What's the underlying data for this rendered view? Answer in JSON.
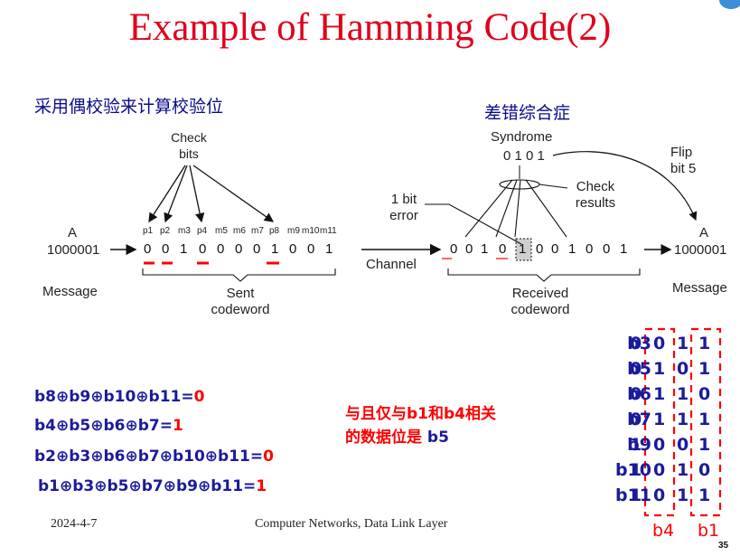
{
  "title": "Example of Hamming Code(2)",
  "left_caption": "采用偶校验来计算校验位",
  "right_caption": "差错综合症",
  "diagram": {
    "check_bits_label": [
      "Check",
      "bits"
    ],
    "sender_a": "A",
    "sender_data": "1000001",
    "message_left": "Message",
    "positions": [
      "p1",
      "p2",
      "m3",
      "p4",
      "m5",
      "m6",
      "m7",
      "p8",
      "m9",
      "m10",
      "m11"
    ],
    "sent_bits": [
      "0",
      "0",
      "1",
      "0",
      "0",
      "0",
      "0",
      "1",
      "0",
      "0",
      "1"
    ],
    "sent_codeword": [
      "Sent",
      "codeword"
    ],
    "channel": "Channel",
    "one_bit_error": [
      "1 bit",
      "error"
    ],
    "syndrome_label": "Syndrome",
    "syndrome_value": "0 1 0 1",
    "check_results": [
      "Check",
      "results"
    ],
    "received_bits": [
      "0",
      "0",
      "1",
      "0",
      "1",
      "0",
      "0",
      "1",
      "0",
      "0",
      "1"
    ],
    "received_codeword": [
      "Received",
      "codeword"
    ],
    "flip_label": [
      "Flip",
      "bit 5"
    ],
    "receiver_a": "A",
    "receiver_data": "1000001",
    "message_right": "Message"
  },
  "equations": [
    {
      "expr": "b8⊕b9⊕b10⊕b11=",
      "result": "0"
    },
    {
      "expr": "b4⊕b5⊕b6⊕b7=",
      "result": "1"
    },
    {
      "expr": "b2⊕b3⊕b6⊕b7⊕b10⊕b11=",
      "result": "0"
    },
    {
      "expr": "b1⊕b3⊕b5⊕b7⊕b9⊕b11=",
      "result": "1"
    }
  ],
  "note": {
    "line1_a": "与且仅与",
    "line1_b": "b1",
    "line1_c": "和",
    "line1_d": "b4",
    "line1_e": "相关",
    "line2_a": "的数据位是 ",
    "line2_b": "b5"
  },
  "table": {
    "rows": [
      {
        "name": "b3",
        "bits": [
          "0",
          "0",
          "1",
          "1"
        ]
      },
      {
        "name": "b5",
        "bits": [
          "0",
          "1",
          "0",
          "1"
        ]
      },
      {
        "name": "b6",
        "bits": [
          "0",
          "1",
          "1",
          "0"
        ]
      },
      {
        "name": "b7",
        "bits": [
          "0",
          "1",
          "1",
          "1"
        ]
      },
      {
        "name": "b9",
        "bits": [
          "1",
          "0",
          "0",
          "1"
        ]
      },
      {
        "name": "b10",
        "bits": [
          "1",
          "0",
          "1",
          "0"
        ]
      },
      {
        "name": "b11",
        "bits": [
          "1",
          "0",
          "1",
          "1"
        ]
      }
    ],
    "col_label_b4": "b4",
    "col_label_b1": "b1"
  },
  "footer": {
    "date": "2024-4-7",
    "course": "Computer Networks, Data Link Layer",
    "page": "35"
  },
  "colors": {
    "title": "#e0001b",
    "caption": "#0a0a8c",
    "equation": "#1a1a9c",
    "highlight": "#ff0000",
    "accent": "#3b8fd9"
  }
}
